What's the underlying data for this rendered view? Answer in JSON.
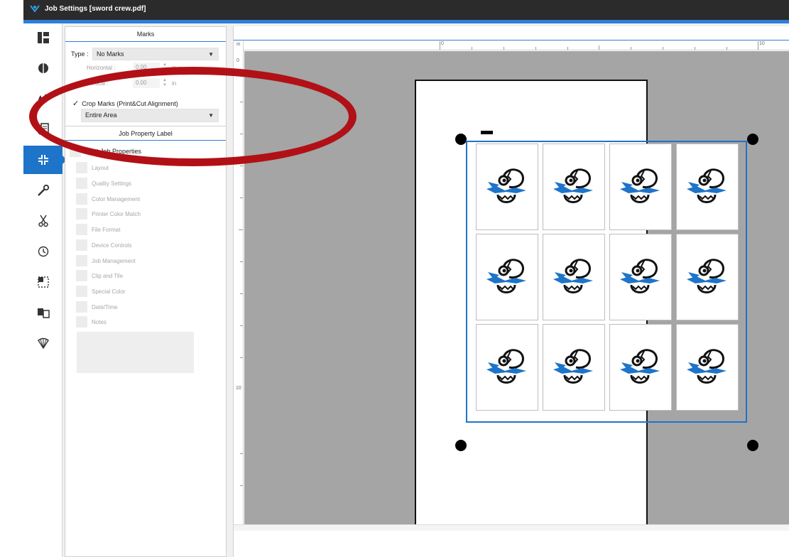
{
  "window": {
    "title": "Job Settings [sword crew.pdf]"
  },
  "iconbar": {
    "items": [
      {
        "id": "layout",
        "icon": "layout-icon",
        "glyph": "▚"
      },
      {
        "id": "quality",
        "icon": "quality-icon",
        "glyph": "◑"
      },
      {
        "id": "color",
        "icon": "ink-drops-icon",
        "glyph": "💧"
      },
      {
        "id": "printer-color",
        "icon": "printer-color-icon",
        "glyph": "🖶"
      },
      {
        "id": "marks",
        "icon": "marks-icon",
        "glyph": "⌗",
        "active": true
      },
      {
        "id": "device",
        "icon": "wrench-icon",
        "glyph": "🔧"
      },
      {
        "id": "cut",
        "icon": "scissors-icon",
        "glyph": "✂"
      },
      {
        "id": "time",
        "icon": "clock-icon",
        "glyph": "◷"
      },
      {
        "id": "clip",
        "icon": "clip-tile-icon",
        "glyph": "⬚"
      },
      {
        "id": "rip",
        "icon": "rip-icon",
        "glyph": "▣"
      },
      {
        "id": "special",
        "icon": "special-color-icon",
        "glyph": "⚜"
      }
    ]
  },
  "marks": {
    "header": "Marks",
    "type_label": "Type :",
    "type_value": "No Marks",
    "horizontal_label": "Horizontal :",
    "horizontal_value": "0.00",
    "vertical_label": "Vertical :",
    "vertical_value": "0.00",
    "unit": "in",
    "crop_marks_label": "Crop Marks (Print&Cut Alignment)",
    "crop_marks_checked": true,
    "area_value": "Entire Area"
  },
  "job_property": {
    "header": "Job Property Label",
    "items": [
      "Print Job Properties",
      "Layout",
      "Quality Settings",
      "Color Management",
      "Printer Color Match",
      "File Format",
      "Device Controls",
      "Job Management",
      "Clip and Tile",
      "Special Color",
      "Date/Time",
      "Notes"
    ]
  },
  "ruler": {
    "h_labels": [
      "0",
      "10"
    ],
    "v_labels": [
      "0",
      "10"
    ],
    "corner": "in"
  },
  "preview": {
    "tiles": 12,
    "colors": {
      "frame": "#1e74c9",
      "mascot_blue": "#1e74c9",
      "annotation": "#b11116"
    }
  }
}
